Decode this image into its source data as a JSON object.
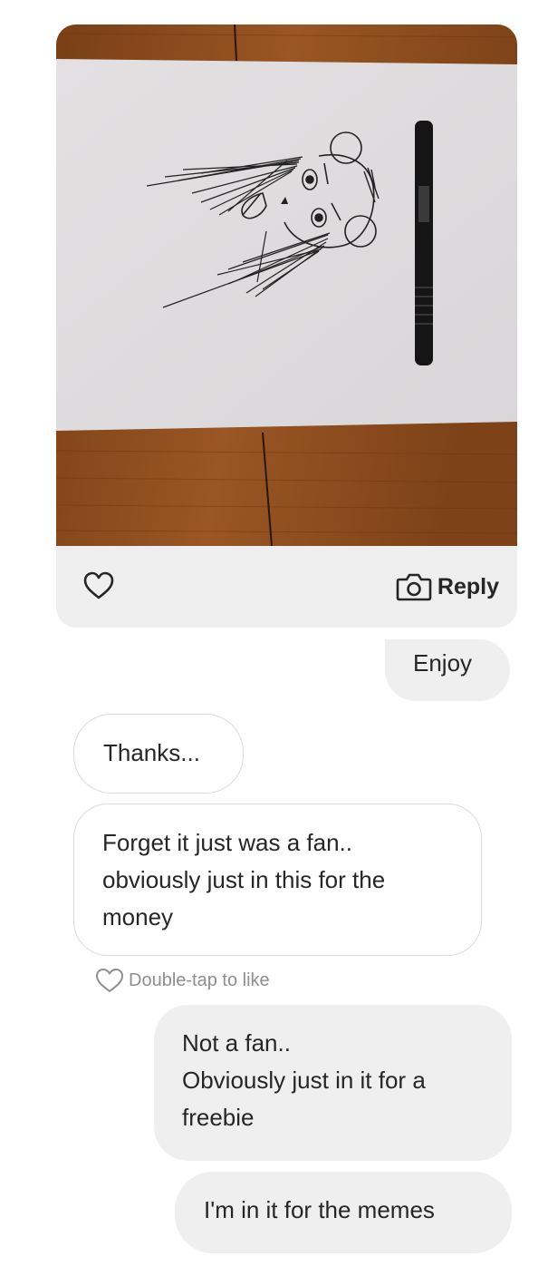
{
  "messages": [
    {
      "id": "enjoy",
      "direction": "sent",
      "lines": [
        "Enjoy"
      ]
    },
    {
      "id": "thanks",
      "direction": "received",
      "lines": [
        "Thanks..."
      ]
    },
    {
      "id": "forget",
      "direction": "received",
      "lines": [
        "Forget it just was a fan..",
        "obviously just in this for the",
        "money"
      ]
    },
    {
      "id": "notafan",
      "direction": "sent",
      "lines": [
        "Not a fan..",
        "Obviously just in it for a",
        "freebie"
      ]
    },
    {
      "id": "memes",
      "direction": "sent",
      "lines": [
        "I'm in it for the memes"
      ]
    }
  ],
  "photo_message": {
    "icons": [
      "heart-outline-icon",
      "camera-icon"
    ],
    "reply_label": "Reply"
  },
  "double_tap_hint": "Double-tap to like",
  "colors": {
    "sent_bubble": "#efefef",
    "received_border": "#dbdbdb",
    "text": "#262626",
    "hint_text": "#8e8e8e",
    "wood": "#8a4a1c"
  }
}
